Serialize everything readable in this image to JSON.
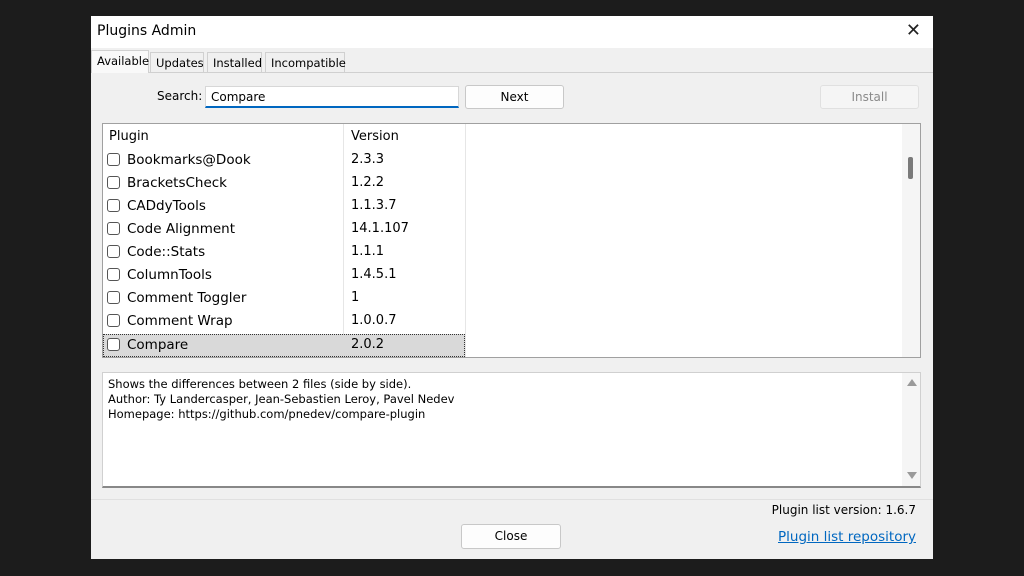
{
  "window": {
    "title": "Plugins Admin"
  },
  "tabs": [
    {
      "label": "Available"
    },
    {
      "label": "Updates"
    },
    {
      "label": "Installed"
    },
    {
      "label": "Incompatible"
    }
  ],
  "search": {
    "label": "Search:",
    "value": "Compare"
  },
  "buttons": {
    "next": "Next",
    "install": "Install",
    "close": "Close"
  },
  "list": {
    "headers": {
      "plugin": "Plugin",
      "version": "Version"
    },
    "rows": [
      {
        "name": "Bookmarks@Dook",
        "version": "2.3.3"
      },
      {
        "name": "BracketsCheck",
        "version": "1.2.2"
      },
      {
        "name": "CADdyTools",
        "version": "1.1.3.7"
      },
      {
        "name": "Code Alignment",
        "version": "14.1.107"
      },
      {
        "name": "Code::Stats",
        "version": "1.1.1"
      },
      {
        "name": "ColumnTools",
        "version": "1.4.5.1"
      },
      {
        "name": "Comment Toggler",
        "version": "1"
      },
      {
        "name": "Comment Wrap",
        "version": "1.0.0.7"
      },
      {
        "name": "Compare",
        "version": "2.0.2",
        "selected": true
      }
    ]
  },
  "description": {
    "lines": [
      "Shows the differences between 2 files (side by side).",
      "Author: Ty Landercasper, Jean-Sebastien Leroy, Pavel Nedev",
      "Homepage: https://github.com/pnedev/compare-plugin"
    ]
  },
  "footer": {
    "plugin_list_version": "Plugin list version:  1.6.7",
    "repo_link": "Plugin list repository"
  },
  "colors": {
    "accent": "#0067c0",
    "selected_row": "#d9d9d9",
    "background": "#1c1c1c"
  }
}
